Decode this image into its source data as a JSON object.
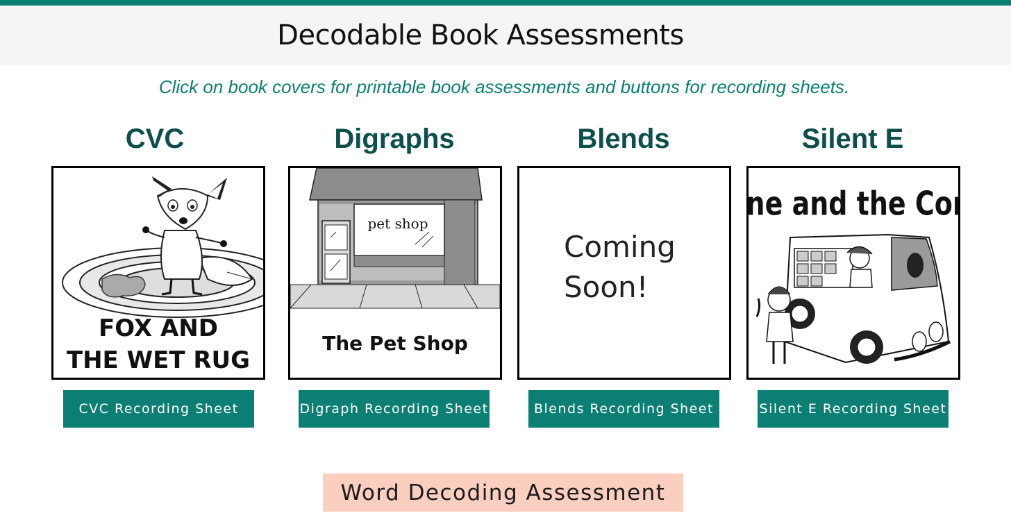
{
  "header": {
    "title": "Decodable Book Assessments"
  },
  "subtitle": "Click on book covers for printable book assessments and buttons for recording sheets.",
  "columns": [
    {
      "heading": "CVC",
      "cover_title_line1": "FOX AND",
      "cover_title_line2": "THE WET RUG",
      "button": "CVC Recording Sheet"
    },
    {
      "heading": "Digraphs",
      "cover_sign": "pet shop",
      "cover_title": "The Pet Shop",
      "button": "Digraph Recording Sheet"
    },
    {
      "heading": "Blends",
      "cover_line1": "Coming",
      "cover_line2": "Soon!",
      "button": "Blends Recording Sheet"
    },
    {
      "heading": "Silent E",
      "cover_title": "June and the Cone",
      "button": "Silent E Recording Sheet"
    }
  ],
  "footer_button": "Word Decoding Assessment",
  "colors": {
    "accent": "#0b7f74",
    "heading": "#0d4f4a",
    "peach_button": "#fbcfc0",
    "header_bg": "#f5f5f5"
  }
}
